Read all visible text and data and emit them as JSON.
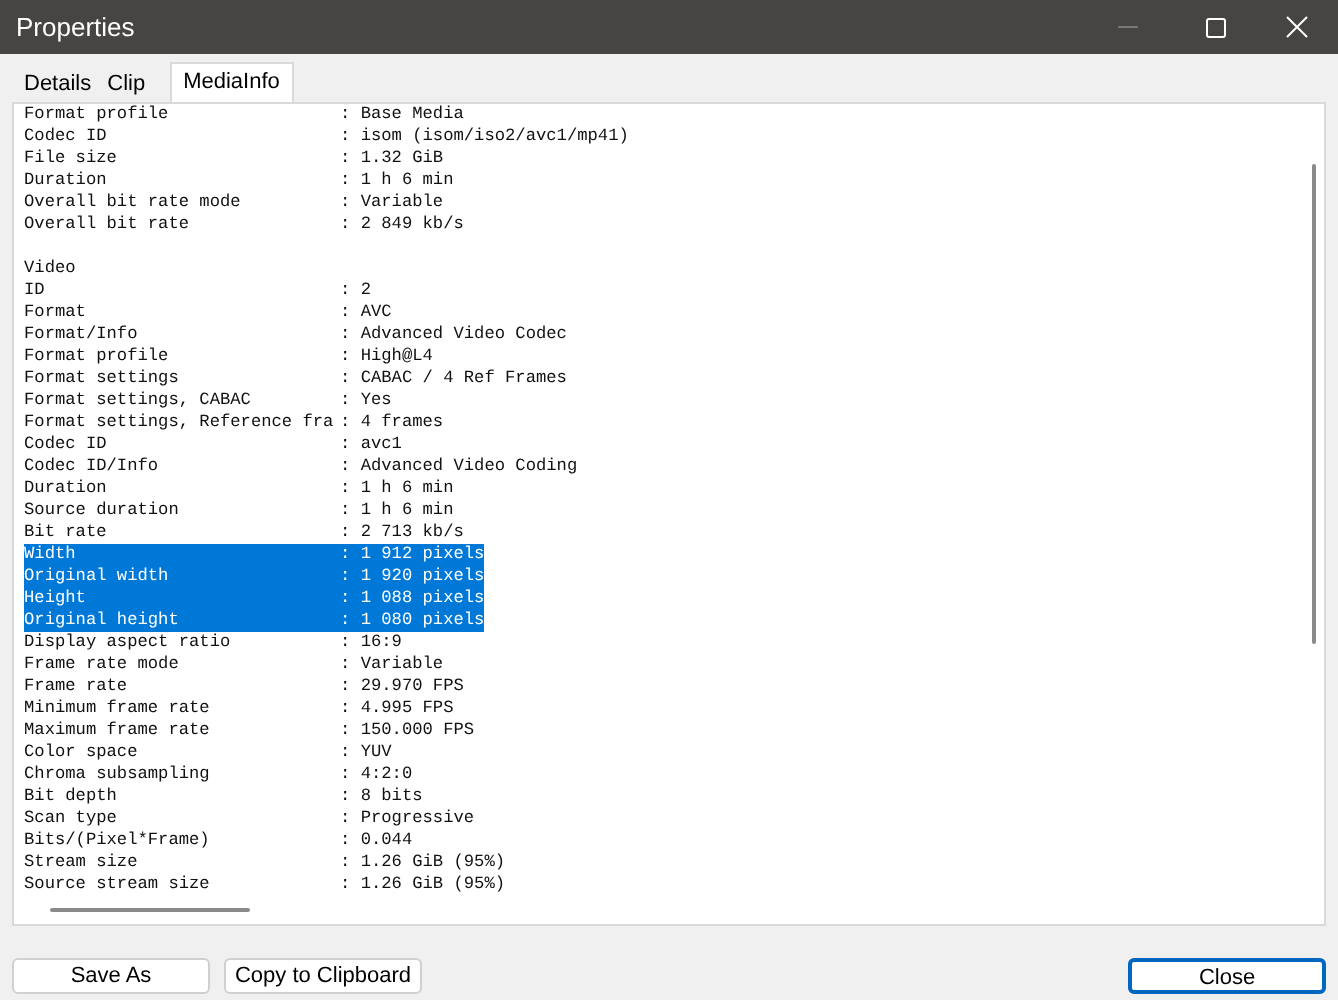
{
  "window": {
    "title": "Properties"
  },
  "tabs": [
    {
      "label": "Details",
      "selected": false
    },
    {
      "label": "Clip",
      "selected": false
    },
    {
      "label": "MediaInfo",
      "selected": true
    }
  ],
  "lines": [
    {
      "kind": "field",
      "label": "Format profile",
      "value": ": Base Media",
      "selected": false
    },
    {
      "kind": "field",
      "label": "Codec ID",
      "value": ": isom (isom/iso2/avc1/mp41)",
      "selected": false
    },
    {
      "kind": "field",
      "label": "File size",
      "value": ": 1.32 GiB",
      "selected": false
    },
    {
      "kind": "field",
      "label": "Duration",
      "value": ": 1 h 6 min",
      "selected": false
    },
    {
      "kind": "field",
      "label": "Overall bit rate mode",
      "value": ": Variable",
      "selected": false
    },
    {
      "kind": "field",
      "label": "Overall bit rate",
      "value": ": 2 849 kb/s",
      "selected": false
    },
    {
      "kind": "blank"
    },
    {
      "kind": "section",
      "label": "Video"
    },
    {
      "kind": "field",
      "label": "ID",
      "value": ": 2",
      "selected": false
    },
    {
      "kind": "field",
      "label": "Format",
      "value": ": AVC",
      "selected": false
    },
    {
      "kind": "field",
      "label": "Format/Info",
      "value": ": Advanced Video Codec",
      "selected": false
    },
    {
      "kind": "field",
      "label": "Format profile",
      "value": ": High@L4",
      "selected": false
    },
    {
      "kind": "field",
      "label": "Format settings",
      "value": ": CABAC / 4 Ref Frames",
      "selected": false
    },
    {
      "kind": "field",
      "label": "Format settings, CABAC",
      "value": ": Yes",
      "selected": false
    },
    {
      "kind": "field",
      "label": "Format settings, Reference fra",
      "value": ": 4 frames",
      "selected": false
    },
    {
      "kind": "field",
      "label": "Codec ID",
      "value": ": avc1",
      "selected": false
    },
    {
      "kind": "field",
      "label": "Codec ID/Info",
      "value": ": Advanced Video Coding",
      "selected": false
    },
    {
      "kind": "field",
      "label": "Duration",
      "value": ": 1 h 6 min",
      "selected": false
    },
    {
      "kind": "field",
      "label": "Source duration",
      "value": ": 1 h 6 min",
      "selected": false
    },
    {
      "kind": "field",
      "label": "Bit rate",
      "value": ": 2 713 kb/s",
      "selected": false
    },
    {
      "kind": "field",
      "label": "Width",
      "value": ": 1 912 pixels",
      "selected": true
    },
    {
      "kind": "field",
      "label": "Original width",
      "value": ": 1 920 pixels",
      "selected": true
    },
    {
      "kind": "field",
      "label": "Height",
      "value": ": 1 088 pixels",
      "selected": true
    },
    {
      "kind": "field",
      "label": "Original height",
      "value": ": 1 080 pixels",
      "selected": true
    },
    {
      "kind": "field",
      "label": "Display aspect ratio",
      "value": ": 16:9",
      "selected": false
    },
    {
      "kind": "field",
      "label": "Frame rate mode",
      "value": ": Variable",
      "selected": false
    },
    {
      "kind": "field",
      "label": "Frame rate",
      "value": ": 29.970 FPS",
      "selected": false
    },
    {
      "kind": "field",
      "label": "Minimum frame rate",
      "value": ": 4.995 FPS",
      "selected": false
    },
    {
      "kind": "field",
      "label": "Maximum frame rate",
      "value": ": 150.000 FPS",
      "selected": false
    },
    {
      "kind": "field",
      "label": "Color space",
      "value": ": YUV",
      "selected": false
    },
    {
      "kind": "field",
      "label": "Chroma subsampling",
      "value": ": 4:2:0",
      "selected": false
    },
    {
      "kind": "field",
      "label": "Bit depth",
      "value": ": 8 bits",
      "selected": false
    },
    {
      "kind": "field",
      "label": "Scan type",
      "value": ": Progressive",
      "selected": false
    },
    {
      "kind": "field",
      "label": "Bits/(Pixel*Frame)",
      "value": ": 0.044",
      "selected": false
    },
    {
      "kind": "field",
      "label": "Stream size",
      "value": ": 1.26 GiB (95%)",
      "selected": false
    },
    {
      "kind": "field",
      "label": "Source stream size",
      "value": ": 1.26 GiB (95%)",
      "selected": false
    }
  ],
  "buttons": [
    {
      "label": "Save As",
      "kind": "left"
    },
    {
      "label": "Copy to Clipboard",
      "kind": "left"
    },
    {
      "label": "Close",
      "kind": "default"
    }
  ]
}
